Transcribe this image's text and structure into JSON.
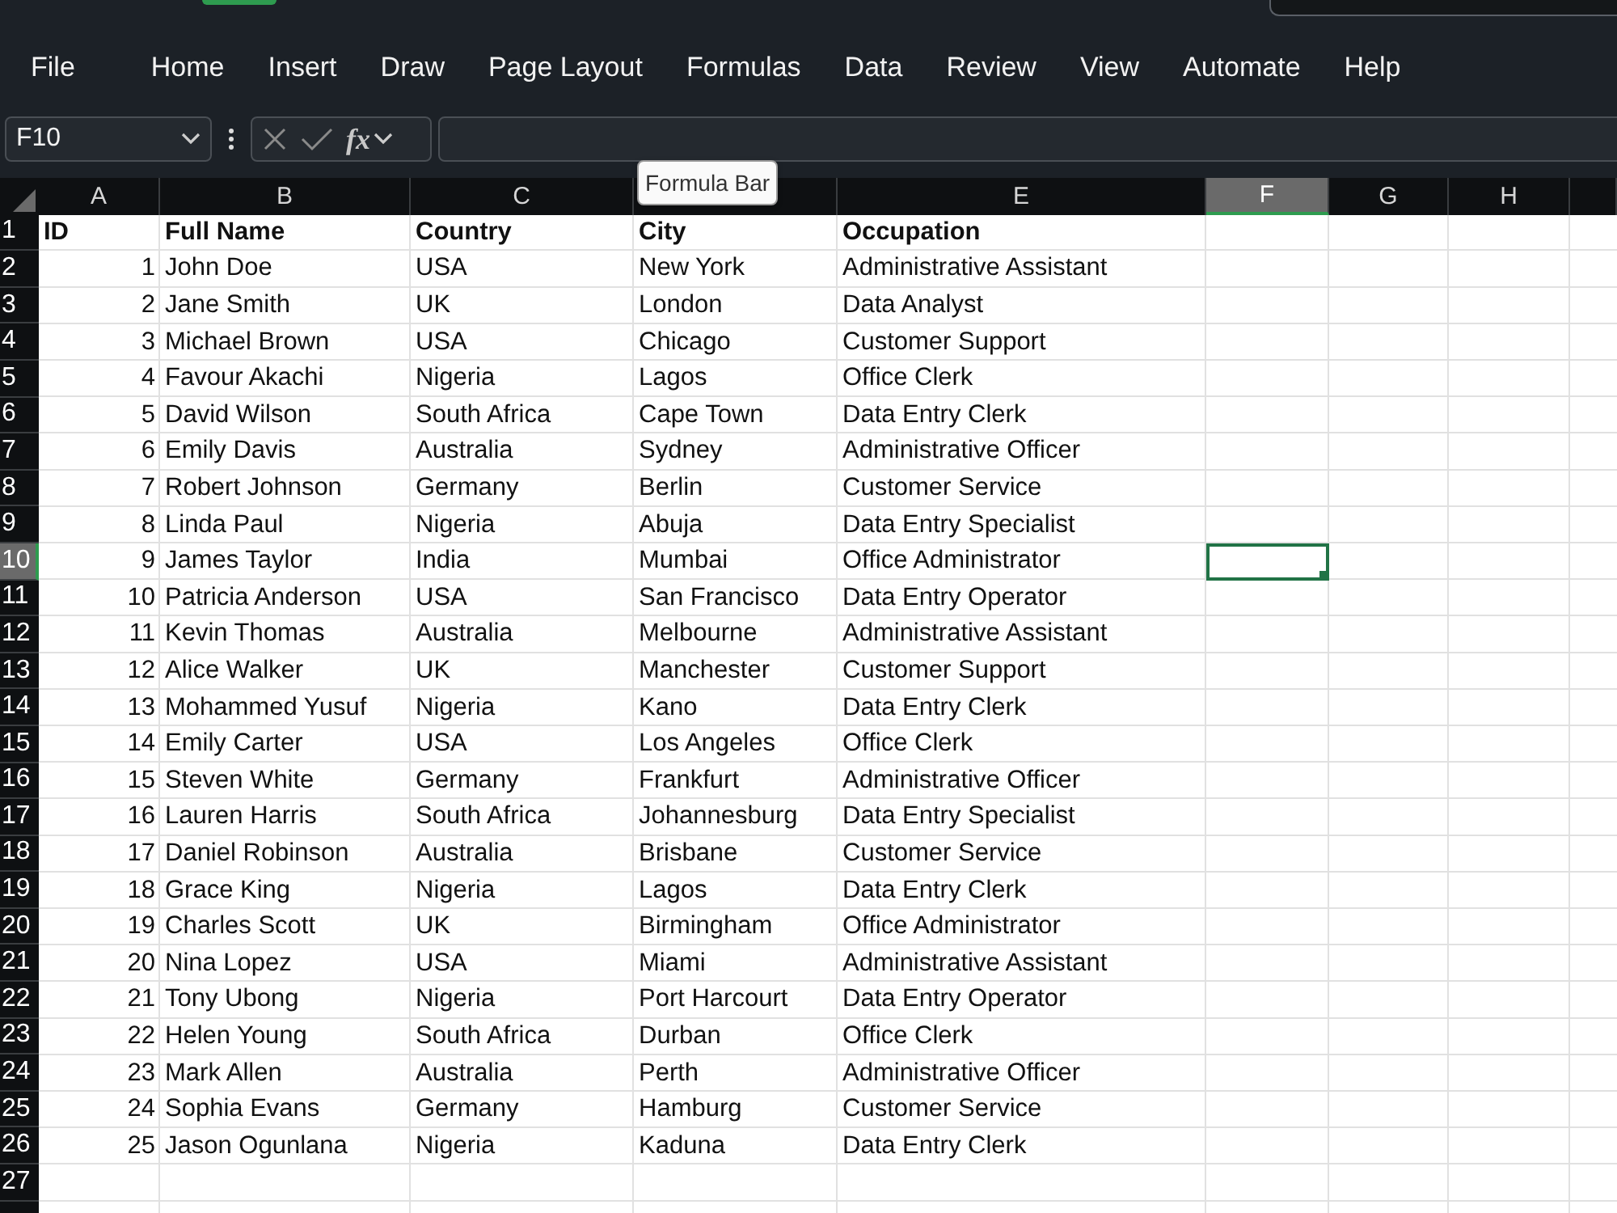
{
  "ribbon_tabs": [
    {
      "label": "File",
      "selected": false
    },
    {
      "label": "Home",
      "selected": false
    },
    {
      "label": "Insert",
      "selected": false
    },
    {
      "label": "Draw",
      "selected": false
    },
    {
      "label": "Page Layout",
      "selected": false
    },
    {
      "label": "Formulas",
      "selected": false
    },
    {
      "label": "Data",
      "selected": false
    },
    {
      "label": "Review",
      "selected": false
    },
    {
      "label": "View",
      "selected": false
    },
    {
      "label": "Automate",
      "selected": false
    },
    {
      "label": "Help",
      "selected": false
    }
  ],
  "formula_bar": {
    "name_box": "F10",
    "function_label": "fx",
    "tooltip": "Formula Bar"
  },
  "columns": [
    {
      "label": "A",
      "selected": false
    },
    {
      "label": "B",
      "selected": false
    },
    {
      "label": "C",
      "selected": false
    },
    {
      "selected": false
    },
    {
      "label": "E",
      "selected": false
    },
    {
      "label": "F",
      "selected": true
    },
    {
      "label": "G",
      "selected": false
    },
    {
      "label": "H",
      "selected": false
    }
  ],
  "rows": [
    {
      "number": "1",
      "kind": "header",
      "selected": false,
      "cells": [
        "ID",
        "Full Name",
        "Country",
        "City",
        "Occupation"
      ]
    },
    {
      "number": "2",
      "kind": "data",
      "selected": false,
      "cells": [
        "1",
        "John Doe",
        "USA",
        "New York",
        "Administrative Assistant"
      ]
    },
    {
      "number": "3",
      "kind": "data",
      "selected": false,
      "cells": [
        "2",
        "Jane Smith",
        "UK",
        "London",
        "Data Analyst"
      ]
    },
    {
      "number": "4",
      "kind": "data",
      "selected": false,
      "cells": [
        "3",
        "Michael Brown",
        "USA",
        "Chicago",
        "Customer Support"
      ]
    },
    {
      "number": "5",
      "kind": "data",
      "selected": false,
      "cells": [
        "4",
        "Favour Akachi",
        "Nigeria",
        "Lagos",
        "Office Clerk"
      ]
    },
    {
      "number": "6",
      "kind": "data",
      "selected": false,
      "cells": [
        "5",
        "David Wilson",
        "South Africa",
        "Cape Town",
        "Data Entry Clerk"
      ]
    },
    {
      "number": "7",
      "kind": "data",
      "selected": false,
      "cells": [
        "6",
        "Emily Davis",
        "Australia",
        "Sydney",
        "Administrative Officer"
      ]
    },
    {
      "number": "8",
      "kind": "data",
      "selected": false,
      "cells": [
        "7",
        "Robert Johnson",
        "Germany",
        "Berlin",
        "Customer Service"
      ]
    },
    {
      "number": "9",
      "kind": "data",
      "selected": false,
      "cells": [
        "8",
        "Linda Paul",
        "Nigeria",
        "Abuja",
        "Data Entry Specialist"
      ]
    },
    {
      "number": "10",
      "kind": "data",
      "selected": true,
      "cells": [
        "9",
        "James Taylor",
        "India",
        "Mumbai",
        "Office Administrator"
      ]
    },
    {
      "number": "11",
      "kind": "data",
      "selected": false,
      "cells": [
        "10",
        "Patricia Anderson",
        "USA",
        "San Francisco",
        "Data Entry Operator"
      ]
    },
    {
      "number": "12",
      "kind": "data",
      "selected": false,
      "cells": [
        "11",
        "Kevin Thomas",
        "Australia",
        "Melbourne",
        "Administrative Assistant"
      ]
    },
    {
      "number": "13",
      "kind": "data",
      "selected": false,
      "cells": [
        "12",
        "Alice Walker",
        "UK",
        "Manchester",
        "Customer Support"
      ]
    },
    {
      "number": "14",
      "kind": "data",
      "selected": false,
      "cells": [
        "13",
        "Mohammed Yusuf",
        "Nigeria",
        "Kano",
        "Data Entry Clerk"
      ]
    },
    {
      "number": "15",
      "kind": "data",
      "selected": false,
      "cells": [
        "14",
        "Emily Carter",
        "USA",
        "Los Angeles",
        "Office Clerk"
      ]
    },
    {
      "number": "16",
      "kind": "data",
      "selected": false,
      "cells": [
        "15",
        "Steven White",
        "Germany",
        "Frankfurt",
        "Administrative Officer"
      ]
    },
    {
      "number": "17",
      "kind": "data",
      "selected": false,
      "cells": [
        "16",
        "Lauren Harris",
        "South Africa",
        "Johannesburg",
        "Data Entry Specialist"
      ]
    },
    {
      "number": "18",
      "kind": "data",
      "selected": false,
      "cells": [
        "17",
        "Daniel Robinson",
        "Australia",
        "Brisbane",
        "Customer Service"
      ]
    },
    {
      "number": "19",
      "kind": "data",
      "selected": false,
      "cells": [
        "18",
        "Grace King",
        "Nigeria",
        "Lagos",
        "Data Entry Clerk"
      ]
    },
    {
      "number": "20",
      "kind": "data",
      "selected": false,
      "cells": [
        "19",
        "Charles Scott",
        "UK",
        "Birmingham",
        "Office Administrator"
      ]
    },
    {
      "number": "21",
      "kind": "data",
      "selected": false,
      "cells": [
        "20",
        "Nina Lopez",
        "USA",
        "Miami",
        "Administrative Assistant"
      ]
    },
    {
      "number": "22",
      "kind": "data",
      "selected": false,
      "cells": [
        "21",
        "Tony Ubong",
        "Nigeria",
        "Port Harcourt",
        "Data Entry Operator"
      ]
    },
    {
      "number": "23",
      "kind": "data",
      "selected": false,
      "cells": [
        "22",
        "Helen Young",
        "South Africa",
        "Durban",
        "Office Clerk"
      ]
    },
    {
      "number": "24",
      "kind": "data",
      "selected": false,
      "cells": [
        "23",
        "Mark Allen",
        "Australia",
        "Perth",
        "Administrative Officer"
      ]
    },
    {
      "number": "25",
      "kind": "data",
      "selected": false,
      "cells": [
        "24",
        "Sophia Evans",
        "Germany",
        "Hamburg",
        "Customer Service"
      ]
    },
    {
      "number": "26",
      "kind": "data",
      "selected": false,
      "cells": [
        "25",
        "Jason Ogunlana",
        "Nigeria",
        "Kaduna",
        "Data Entry Clerk"
      ]
    },
    {
      "number": "27",
      "kind": "empty",
      "selected": false
    }
  ]
}
